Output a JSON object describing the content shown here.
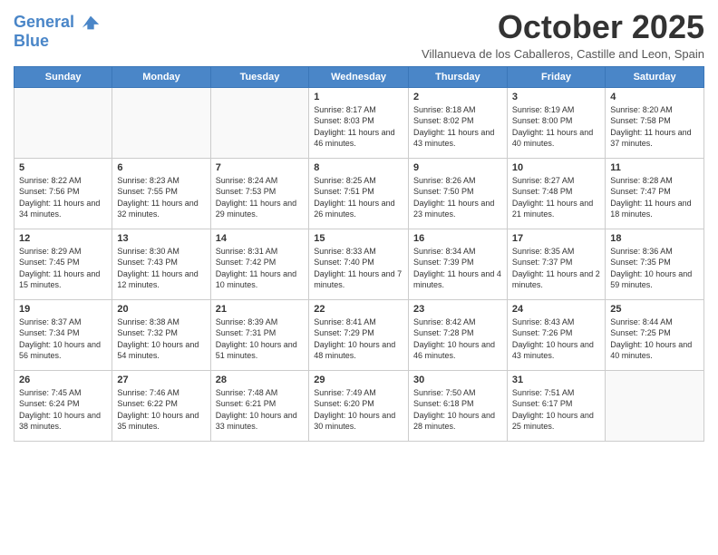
{
  "header": {
    "logo_line1": "General",
    "logo_line2": "Blue",
    "month": "October 2025",
    "subtitle": "Villanueva de los Caballeros, Castille and Leon, Spain"
  },
  "days_of_week": [
    "Sunday",
    "Monday",
    "Tuesday",
    "Wednesday",
    "Thursday",
    "Friday",
    "Saturday"
  ],
  "weeks": [
    [
      {
        "num": "",
        "info": ""
      },
      {
        "num": "",
        "info": ""
      },
      {
        "num": "",
        "info": ""
      },
      {
        "num": "1",
        "info": "Sunrise: 8:17 AM\nSunset: 8:03 PM\nDaylight: 11 hours and 46 minutes."
      },
      {
        "num": "2",
        "info": "Sunrise: 8:18 AM\nSunset: 8:02 PM\nDaylight: 11 hours and 43 minutes."
      },
      {
        "num": "3",
        "info": "Sunrise: 8:19 AM\nSunset: 8:00 PM\nDaylight: 11 hours and 40 minutes."
      },
      {
        "num": "4",
        "info": "Sunrise: 8:20 AM\nSunset: 7:58 PM\nDaylight: 11 hours and 37 minutes."
      }
    ],
    [
      {
        "num": "5",
        "info": "Sunrise: 8:22 AM\nSunset: 7:56 PM\nDaylight: 11 hours and 34 minutes."
      },
      {
        "num": "6",
        "info": "Sunrise: 8:23 AM\nSunset: 7:55 PM\nDaylight: 11 hours and 32 minutes."
      },
      {
        "num": "7",
        "info": "Sunrise: 8:24 AM\nSunset: 7:53 PM\nDaylight: 11 hours and 29 minutes."
      },
      {
        "num": "8",
        "info": "Sunrise: 8:25 AM\nSunset: 7:51 PM\nDaylight: 11 hours and 26 minutes."
      },
      {
        "num": "9",
        "info": "Sunrise: 8:26 AM\nSunset: 7:50 PM\nDaylight: 11 hours and 23 minutes."
      },
      {
        "num": "10",
        "info": "Sunrise: 8:27 AM\nSunset: 7:48 PM\nDaylight: 11 hours and 21 minutes."
      },
      {
        "num": "11",
        "info": "Sunrise: 8:28 AM\nSunset: 7:47 PM\nDaylight: 11 hours and 18 minutes."
      }
    ],
    [
      {
        "num": "12",
        "info": "Sunrise: 8:29 AM\nSunset: 7:45 PM\nDaylight: 11 hours and 15 minutes."
      },
      {
        "num": "13",
        "info": "Sunrise: 8:30 AM\nSunset: 7:43 PM\nDaylight: 11 hours and 12 minutes."
      },
      {
        "num": "14",
        "info": "Sunrise: 8:31 AM\nSunset: 7:42 PM\nDaylight: 11 hours and 10 minutes."
      },
      {
        "num": "15",
        "info": "Sunrise: 8:33 AM\nSunset: 7:40 PM\nDaylight: 11 hours and 7 minutes."
      },
      {
        "num": "16",
        "info": "Sunrise: 8:34 AM\nSunset: 7:39 PM\nDaylight: 11 hours and 4 minutes."
      },
      {
        "num": "17",
        "info": "Sunrise: 8:35 AM\nSunset: 7:37 PM\nDaylight: 11 hours and 2 minutes."
      },
      {
        "num": "18",
        "info": "Sunrise: 8:36 AM\nSunset: 7:35 PM\nDaylight: 10 hours and 59 minutes."
      }
    ],
    [
      {
        "num": "19",
        "info": "Sunrise: 8:37 AM\nSunset: 7:34 PM\nDaylight: 10 hours and 56 minutes."
      },
      {
        "num": "20",
        "info": "Sunrise: 8:38 AM\nSunset: 7:32 PM\nDaylight: 10 hours and 54 minutes."
      },
      {
        "num": "21",
        "info": "Sunrise: 8:39 AM\nSunset: 7:31 PM\nDaylight: 10 hours and 51 minutes."
      },
      {
        "num": "22",
        "info": "Sunrise: 8:41 AM\nSunset: 7:29 PM\nDaylight: 10 hours and 48 minutes."
      },
      {
        "num": "23",
        "info": "Sunrise: 8:42 AM\nSunset: 7:28 PM\nDaylight: 10 hours and 46 minutes."
      },
      {
        "num": "24",
        "info": "Sunrise: 8:43 AM\nSunset: 7:26 PM\nDaylight: 10 hours and 43 minutes."
      },
      {
        "num": "25",
        "info": "Sunrise: 8:44 AM\nSunset: 7:25 PM\nDaylight: 10 hours and 40 minutes."
      }
    ],
    [
      {
        "num": "26",
        "info": "Sunrise: 7:45 AM\nSunset: 6:24 PM\nDaylight: 10 hours and 38 minutes."
      },
      {
        "num": "27",
        "info": "Sunrise: 7:46 AM\nSunset: 6:22 PM\nDaylight: 10 hours and 35 minutes."
      },
      {
        "num": "28",
        "info": "Sunrise: 7:48 AM\nSunset: 6:21 PM\nDaylight: 10 hours and 33 minutes."
      },
      {
        "num": "29",
        "info": "Sunrise: 7:49 AM\nSunset: 6:20 PM\nDaylight: 10 hours and 30 minutes."
      },
      {
        "num": "30",
        "info": "Sunrise: 7:50 AM\nSunset: 6:18 PM\nDaylight: 10 hours and 28 minutes."
      },
      {
        "num": "31",
        "info": "Sunrise: 7:51 AM\nSunset: 6:17 PM\nDaylight: 10 hours and 25 minutes."
      },
      {
        "num": "",
        "info": ""
      }
    ]
  ]
}
